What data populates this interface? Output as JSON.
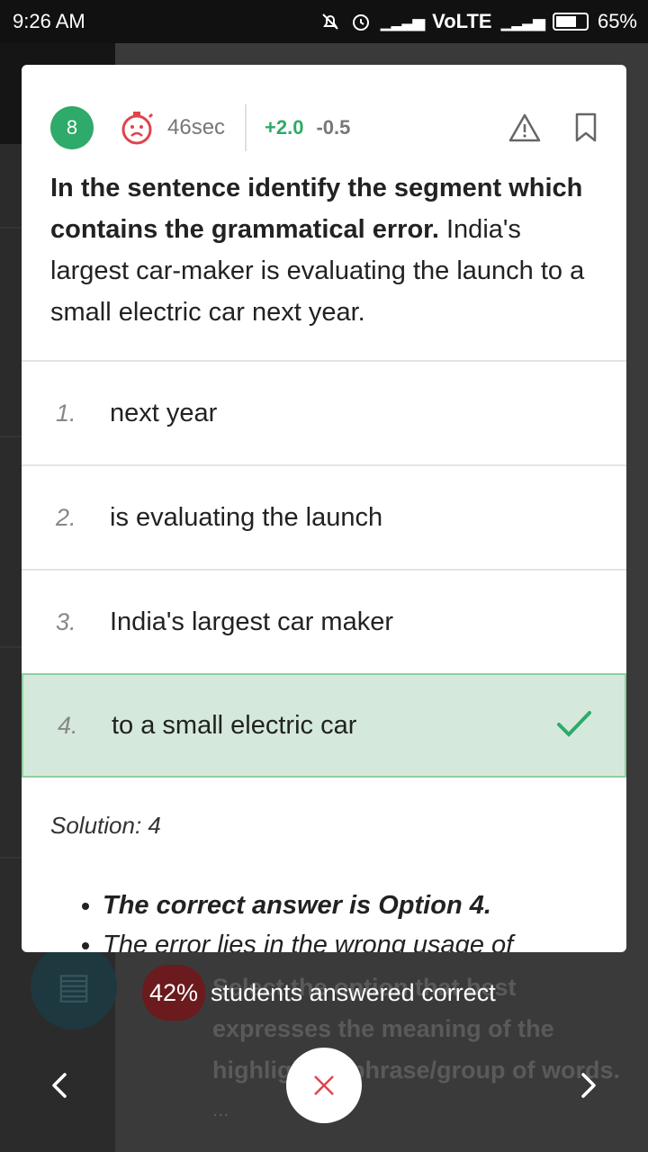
{
  "status_bar": {
    "time": "9:26 AM",
    "network": "VoLTE",
    "battery": "65%"
  },
  "question_meta": {
    "number": "8",
    "time_taken": "46sec",
    "positive_marks": "+2.0",
    "negative_marks": "-0.5"
  },
  "question": {
    "prompt": "In the sentence identify the segment which contains the grammatical error.",
    "sentence": "India's largest car-maker is evaluating the launch to a small electric car next year."
  },
  "options": [
    {
      "num": "1.",
      "text": "next year"
    },
    {
      "num": "2.",
      "text": "is evaluating the launch"
    },
    {
      "num": "3.",
      "text": "India's largest car maker"
    },
    {
      "num": "4.",
      "text": "to a small electric car"
    }
  ],
  "solution": {
    "label": "Solution: 4",
    "bullets": [
      "The correct answer is Option 4.",
      "The error lies in the wrong usage of"
    ]
  },
  "stat": {
    "percent": "42%",
    "label": "students answered correct"
  },
  "background": {
    "next_question": "Select the option that best expresses the meaning of the highlighted phrase/group of words.",
    "ellipsis": "..."
  },
  "colors": {
    "correct_green": "#2eaa6a",
    "correct_bg": "#d4e9db",
    "wrong_red": "#e0444c"
  }
}
